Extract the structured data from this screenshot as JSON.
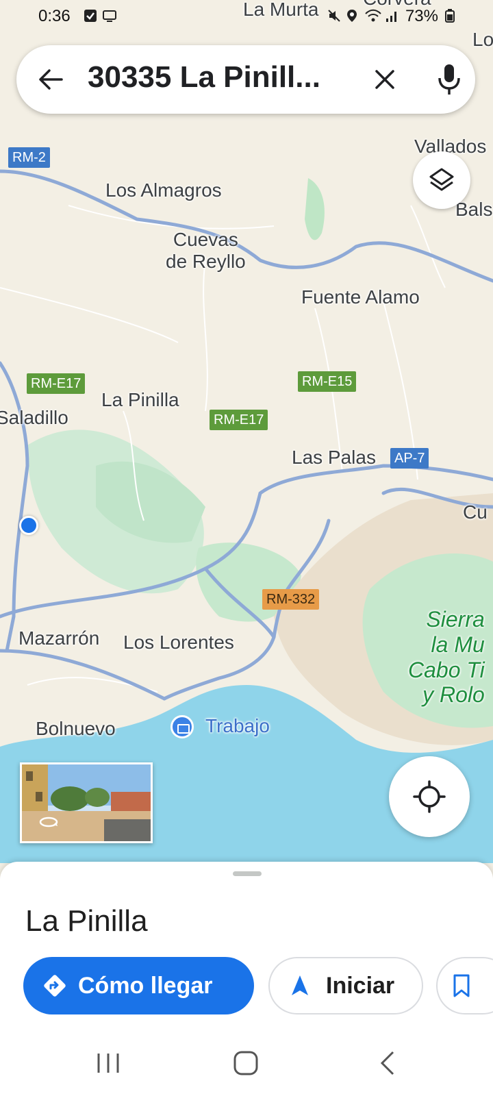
{
  "status_bar": {
    "time": "0:36",
    "battery": "73%"
  },
  "search": {
    "query": "30335 La Pinill..."
  },
  "map": {
    "places": [
      {
        "id": "la-murta",
        "label": "La Murta"
      },
      {
        "id": "corvera",
        "label": "Corvera"
      },
      {
        "id": "lo",
        "label": "Lo"
      },
      {
        "id": "valladolises",
        "label": "Vallados"
      },
      {
        "id": "los-almagros",
        "label": "Los Almagros"
      },
      {
        "id": "balsapintada",
        "label": "Bals"
      },
      {
        "id": "cuevas-de-reyllo",
        "label": "Cuevas\nde Reyllo"
      },
      {
        "id": "fuente-alamo",
        "label": "Fuente Alamo"
      },
      {
        "id": "la-pinilla",
        "label": "La Pinilla"
      },
      {
        "id": "saladillo",
        "label": "Saladillo"
      },
      {
        "id": "las-palas",
        "label": "Las Palas"
      },
      {
        "id": "cu",
        "label": "Cu"
      },
      {
        "id": "mazarron",
        "label": "Mazarrón"
      },
      {
        "id": "los-lorentes",
        "label": "Los Lorentes"
      },
      {
        "id": "bolnuevo",
        "label": "Bolnuevo"
      },
      {
        "id": "trabajo",
        "label": "Trabajo"
      },
      {
        "id": "sierra",
        "label": "Sierra\nla Mu\nCabo Ti\ny Rolo"
      }
    ],
    "road_shields": [
      {
        "id": "rm-2",
        "label": "RM-2",
        "color": "#3d79c7"
      },
      {
        "id": "rm-e17-a",
        "label": "RM-E17",
        "color": "#5d9b3b"
      },
      {
        "id": "rm-e15",
        "label": "RM-E15",
        "color": "#5d9b3b"
      },
      {
        "id": "rm-e17-b",
        "label": "RM-E17",
        "color": "#5d9b3b"
      },
      {
        "id": "ap-7",
        "label": "AP-7",
        "color": "#3d79c7"
      },
      {
        "id": "rm-332",
        "label": "RM-332",
        "color": "#e79b48"
      }
    ]
  },
  "bottom_sheet": {
    "place_name": "La Pinilla",
    "directions_label": "Cómo llegar",
    "start_label": "Iniciar"
  },
  "colors": {
    "accent": "#1a73e8",
    "land": "#f3efe4",
    "water": "#8fd4ea",
    "park": "#c9ead4",
    "road": "#8ea9d6"
  }
}
